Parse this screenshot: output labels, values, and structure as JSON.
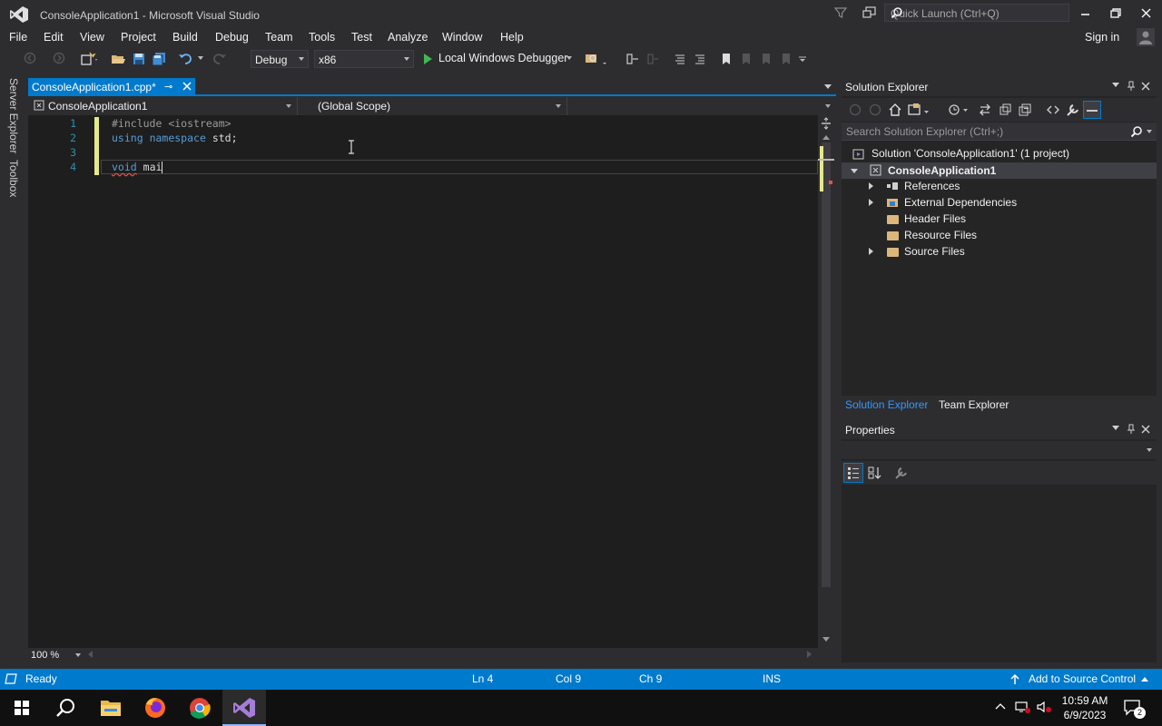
{
  "window": {
    "title": "ConsoleApplication1 - Microsoft Visual Studio",
    "quick_launch_placeholder": "Quick Launch (Ctrl+Q)",
    "sign_in": "Sign in"
  },
  "menu": [
    "File",
    "Edit",
    "View",
    "Project",
    "Build",
    "Debug",
    "Team",
    "Tools",
    "Test",
    "Analyze",
    "Window",
    "Help"
  ],
  "toolbar": {
    "configuration": "Debug",
    "platform": "x86",
    "debugger": "Local Windows Debugger"
  },
  "left_dock": [
    "Server Explorer",
    "Toolbox"
  ],
  "editor": {
    "tab_label": "ConsoleApplication1.cpp*",
    "pin_glyph": "⊸",
    "project_scope": "ConsoleApplication1",
    "global_scope": "(Global Scope)",
    "line_numbers": [
      "1",
      "2",
      "3",
      "4"
    ],
    "line1_directive": "#include",
    "line1_header": "<iostream>",
    "line2_kw1": "using",
    "line2_kw2": "namespace",
    "line2_rest": "std;",
    "line4_kw": "void",
    "line4_rest": "mai",
    "zoom": "100 %"
  },
  "solution_explorer": {
    "title": "Solution Explorer",
    "search_placeholder": "Search Solution Explorer (Ctrl+;)",
    "solution": "Solution 'ConsoleApplication1' (1 project)",
    "project": "ConsoleApplication1",
    "items": [
      "References",
      "External Dependencies",
      "Header Files",
      "Resource Files",
      "Source Files"
    ],
    "tab_solution": "Solution Explorer",
    "tab_team": "Team Explorer"
  },
  "properties": {
    "title": "Properties"
  },
  "status": {
    "state": "Ready",
    "line": "Ln 4",
    "col": "Col 9",
    "ch": "Ch 9",
    "mode": "INS",
    "source_control": "Add to Source Control"
  },
  "taskbar": {
    "time": "10:59 AM",
    "date": "6/9/2023",
    "notification_count": "2"
  },
  "colors": {
    "accent": "#007acc",
    "keyword": "#569cd6",
    "line_number": "#2b91af",
    "background": "#1e1e1e"
  }
}
